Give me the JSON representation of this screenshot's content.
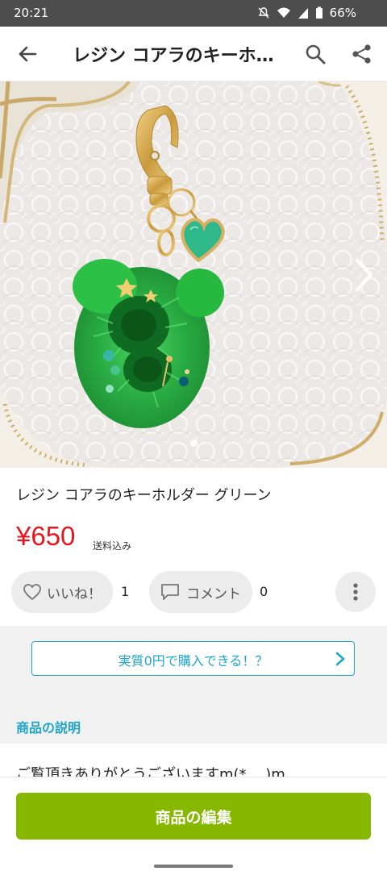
{
  "status_bar": {
    "time": "20:21",
    "battery": "66%",
    "icons": [
      "mute-icon",
      "wifi-icon",
      "signal-icon",
      "battery-icon"
    ]
  },
  "app_bar": {
    "title": "レジン コアラのキーホルダー グリーン",
    "icons": [
      "back-arrow-icon",
      "search-icon",
      "share-icon"
    ]
  },
  "hero": {
    "image_description_icon": "product-photo",
    "carousel_total": 2,
    "carousel_active": 0
  },
  "product": {
    "title": "レジン コアラのキーホルダー グリーン",
    "price": "¥650",
    "shipping": "送料込み"
  },
  "actions": {
    "like_label": "いいね！",
    "like_count": "1",
    "comment_label": "コメント",
    "comment_count": "0"
  },
  "promo": {
    "label": "実質0円で購入できる！？"
  },
  "description": {
    "section_title": "商品の説明",
    "first_line": "ご覧頂きありがとうございますm(*_ _)m"
  },
  "bottom": {
    "edit_button": "商品の編集"
  },
  "colors": {
    "accent_teal": "#1fa5c8",
    "price_red": "#e8171f",
    "edit_green": "#86b800",
    "status_bar": "#4d4d4d"
  }
}
